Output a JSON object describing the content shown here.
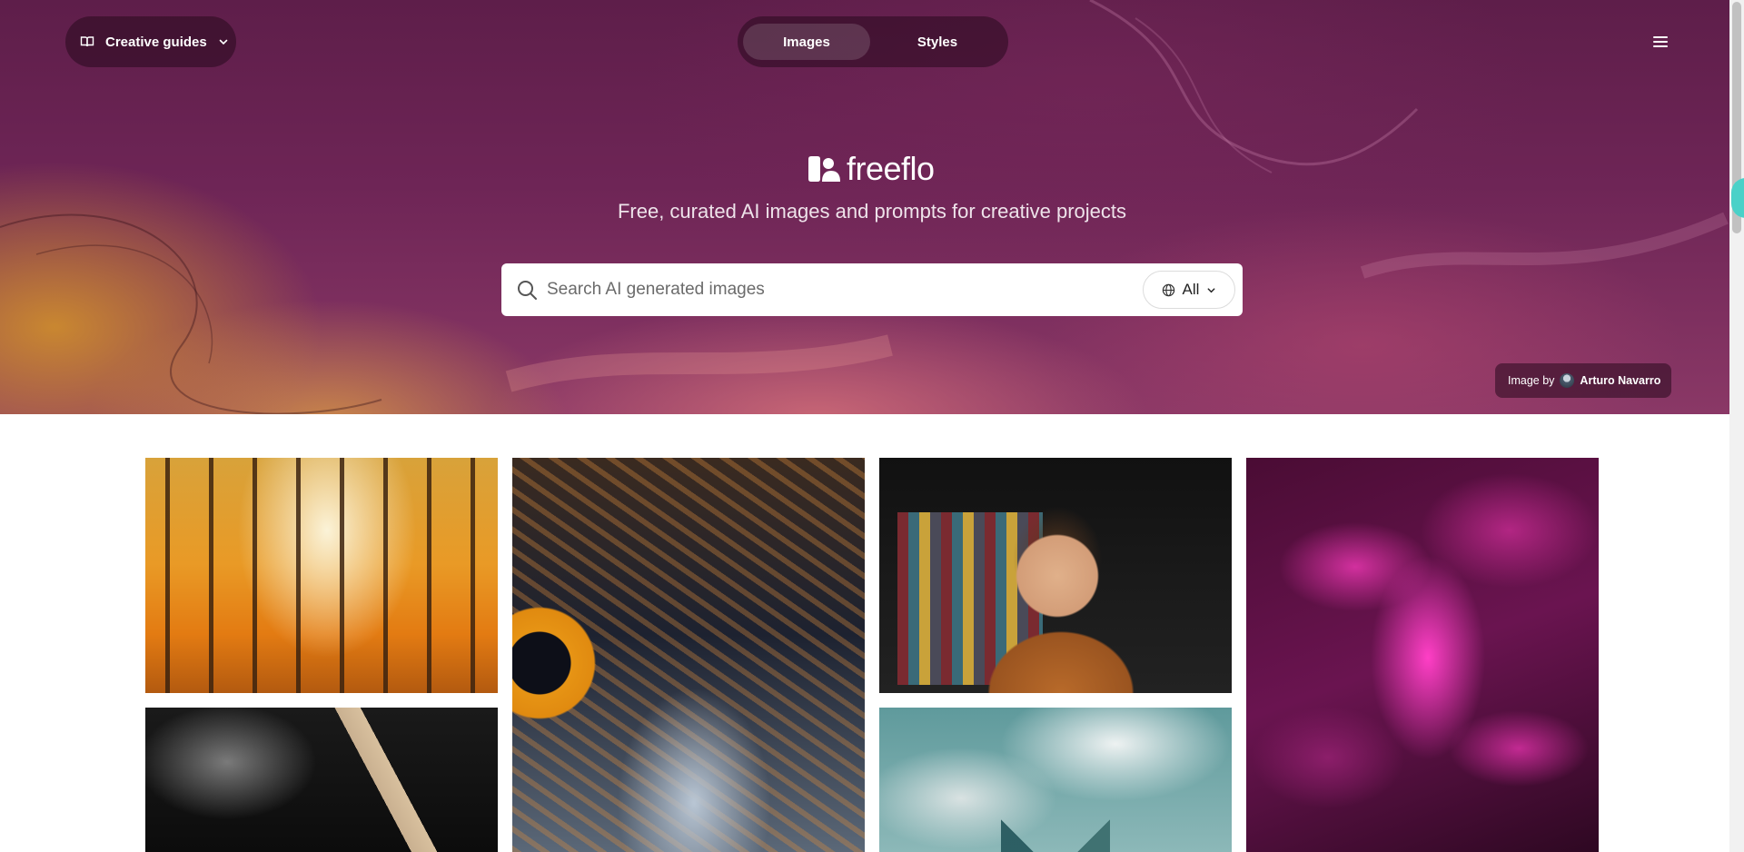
{
  "header": {
    "guides_label": "Creative guides",
    "tabs": [
      {
        "label": "Images",
        "active": true
      },
      {
        "label": "Styles",
        "active": false
      }
    ]
  },
  "hero": {
    "brand": "freeflo",
    "tagline": "Free, curated AI images and prompts for creative projects",
    "search": {
      "placeholder": "Search AI generated images",
      "value": "",
      "filter_label": "All"
    },
    "credit": {
      "prefix": "Image by",
      "author": "Arturo Navarro"
    }
  },
  "gallery": {
    "items": [
      {
        "name": "autumn-forest-painting"
      },
      {
        "name": "owl-eye-closeup"
      },
      {
        "name": "smiling-man-clothing-rack"
      },
      {
        "name": "magenta-leaves"
      },
      {
        "name": "smoking-pipe"
      },
      {
        "name": "building-in-clouds"
      }
    ]
  },
  "colors": {
    "hero_top": "#5e1e4a",
    "hero_bottom": "#8a3866",
    "accent_gold": "#d6962a",
    "panel": "#280a1e"
  },
  "icons": [
    "book-icon",
    "chevron-down-icon",
    "menu-icon",
    "freeflo-logo-icon",
    "search-icon",
    "globe-icon",
    "avatar"
  ]
}
